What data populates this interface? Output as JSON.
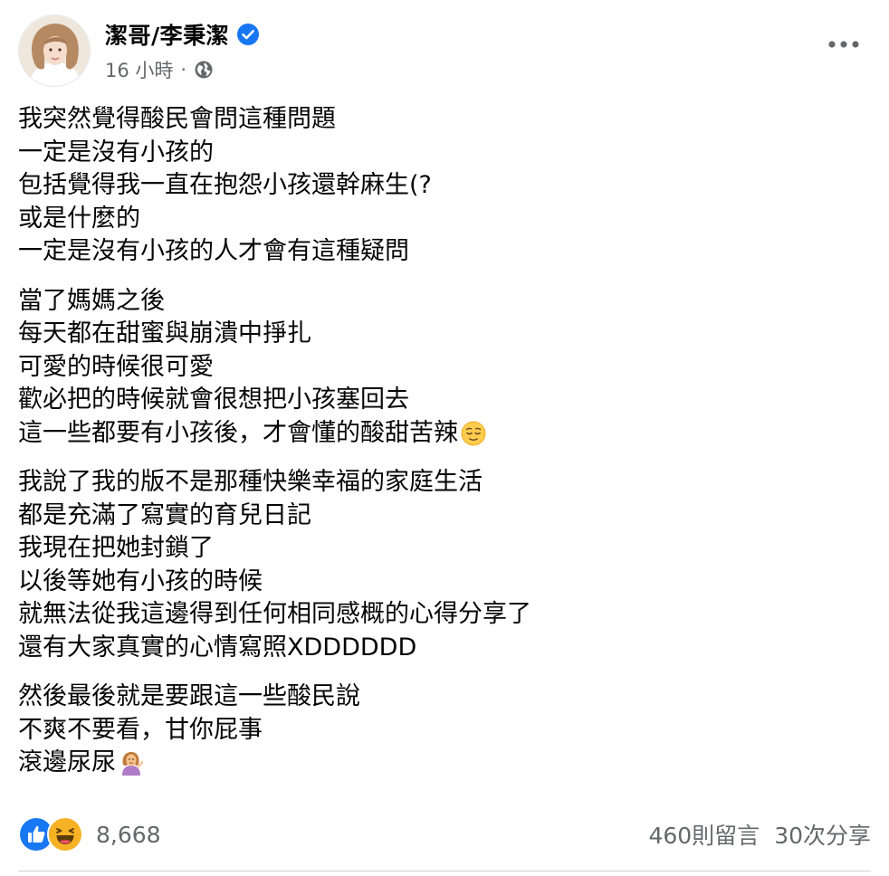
{
  "author": {
    "name": "潔哥/李秉潔",
    "verified": true,
    "avatar_icon": "avatar-photo"
  },
  "meta": {
    "time": "16 小時",
    "separator": "·",
    "privacy_icon": "globe-icon"
  },
  "menu": {
    "icon": "more-options-icon"
  },
  "post": {
    "paragraphs": [
      {
        "lines": [
          "我突然覺得酸民會問這種問題",
          "一定是沒有小孩的",
          "包括覺得我一直在抱怨小孩還幹麻生(?",
          "或是什麼的",
          "一定是沒有小孩的人才會有這種疑問"
        ]
      },
      {
        "lines": [
          "當了媽媽之後",
          "每天都在甜蜜與崩潰中掙扎",
          "可愛的時候很可愛",
          "歡必把的時候就會很想把小孩塞回去",
          "這一些都要有小孩後，才會懂的酸甜苦辣"
        ],
        "trailing_emoji": "relieved-face-emoji"
      },
      {
        "lines": [
          "我說了我的版不是那種快樂幸福的家庭生活",
          "都是充滿了寫實的育兒日記",
          "我現在把她封鎖了",
          "以後等她有小孩的時候",
          "就無法從我這邊得到任何相同感概的心得分享了",
          "還有大家真實的心情寫照XDDDDDD"
        ]
      },
      {
        "lines": [
          "然後最後就是要跟這一些酸民說",
          "不爽不要看，甘你屁事",
          "滾邊尿尿"
        ],
        "trailing_emoji": "tipping-hand-woman-emoji"
      }
    ]
  },
  "footer": {
    "reactions": [
      "like-icon",
      "haha-icon"
    ],
    "reaction_count": "8,668",
    "comments": "460則留言",
    "shares": "30次分享"
  },
  "colors": {
    "text": "#050505",
    "secondary": "#65676b",
    "facebook_blue": "#1877f2",
    "haha_yellow": "#f7b125"
  }
}
